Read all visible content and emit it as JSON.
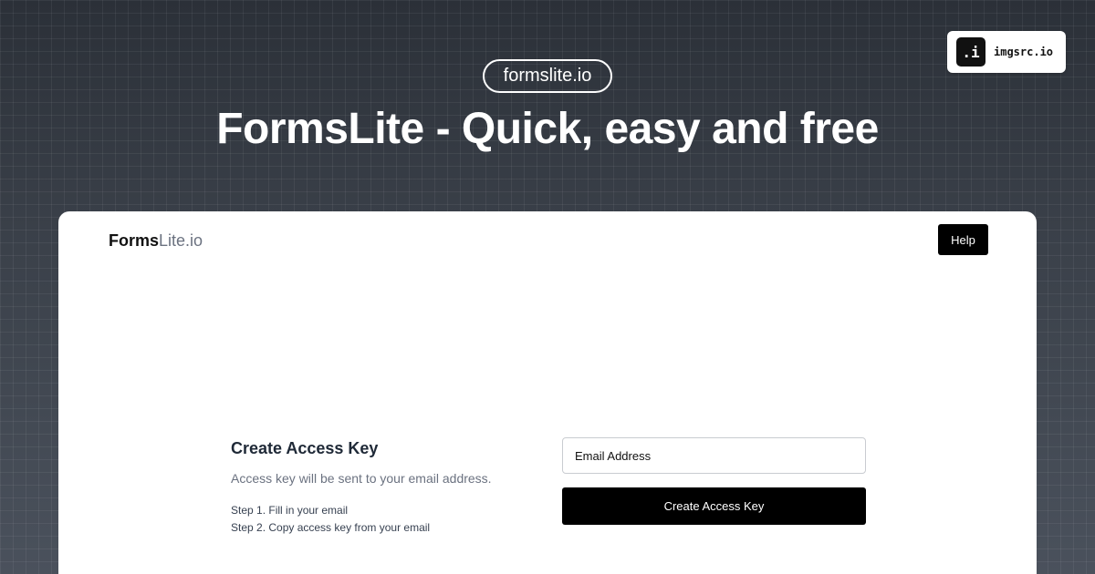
{
  "badge": {
    "icon_text": ".i",
    "icon_name": "imgsrc-logo-icon",
    "label": "imgsrc.io"
  },
  "hero": {
    "domain_pill": "formslite.io",
    "headline": "FormsLite - Quick, easy and free"
  },
  "app": {
    "brand_strong": "Forms",
    "brand_light": "Lite.io",
    "help_label": "Help"
  },
  "form": {
    "title": "Create Access Key",
    "subtitle": "Access key will be sent to your email address.",
    "steps": [
      "Step 1. Fill in your email",
      "Step 2. Copy access key from your email"
    ],
    "email_placeholder": "Email Address",
    "submit_label": "Create Access Key"
  },
  "colors": {
    "accent": "#000000",
    "card_bg": "#ffffff",
    "page_bg": "#3a4049",
    "muted_text": "#6b7280"
  }
}
